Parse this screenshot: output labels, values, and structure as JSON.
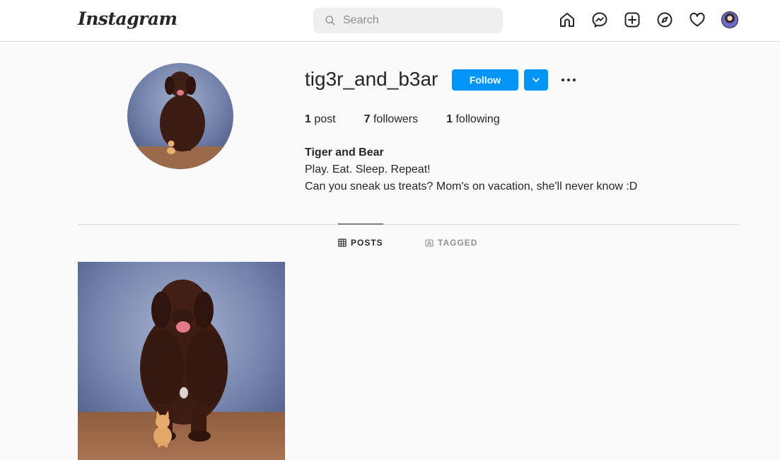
{
  "header": {
    "logo": "Instagram",
    "search_placeholder": "Search",
    "nav": [
      "home-icon",
      "messenger-icon",
      "new-post-icon",
      "explore-icon",
      "activity-icon",
      "profile-avatar"
    ]
  },
  "profile": {
    "username": "tig3r_and_b3ar",
    "follow_label": "Follow",
    "stats": {
      "posts_count": "1",
      "posts_label": "post",
      "followers_count": "7",
      "followers_label": "followers",
      "following_count": "1",
      "following_label": "following"
    },
    "bio": {
      "name": "Tiger and Bear",
      "line1": "Play. Eat. Sleep. Repeat!",
      "line2": "Can you sneak us treats? Mom's on vacation, she'll never know :D"
    }
  },
  "tabs": [
    {
      "label": "POSTS",
      "active": true
    },
    {
      "label": "TAGGED",
      "active": false
    }
  ],
  "colors": {
    "accent": "#0095f6",
    "text": "#262626",
    "muted": "#8e8e8e",
    "border": "#dbdbdb"
  }
}
